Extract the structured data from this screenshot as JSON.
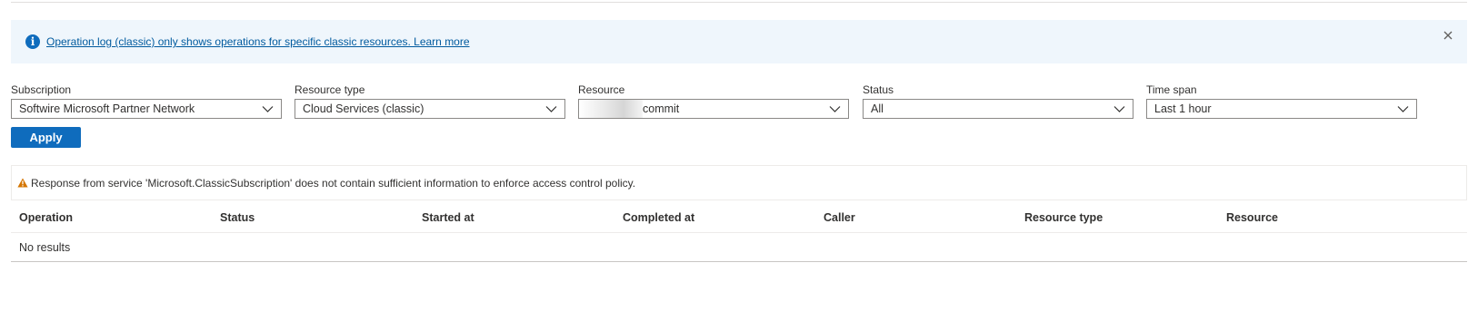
{
  "banner": {
    "message": "Operation log (classic) only shows operations for specific classic resources. Learn more",
    "icon": "info-icon",
    "close_icon": "close-icon"
  },
  "filters": [
    {
      "label": "Subscription",
      "value": "Softwire Microsoft Partner Network"
    },
    {
      "label": "Resource type",
      "value": "Cloud Services (classic)"
    },
    {
      "label": "Resource",
      "value": "commit"
    },
    {
      "label": "Status",
      "value": "All"
    },
    {
      "label": "Time span",
      "value": "Last 1 hour"
    }
  ],
  "apply_label": "Apply",
  "warning": {
    "icon": "warning-icon",
    "text": "Response from service 'Microsoft.ClassicSubscription' does not contain sufficient information to enforce access control policy."
  },
  "table": {
    "columns": [
      "Operation",
      "Status",
      "Started at",
      "Completed at",
      "Caller",
      "Resource type",
      "Resource"
    ],
    "empty_text": "No results"
  },
  "colors": {
    "accent": "#0f6cbd",
    "banner_bg": "#eff6fc",
    "warning": "#d47500"
  }
}
